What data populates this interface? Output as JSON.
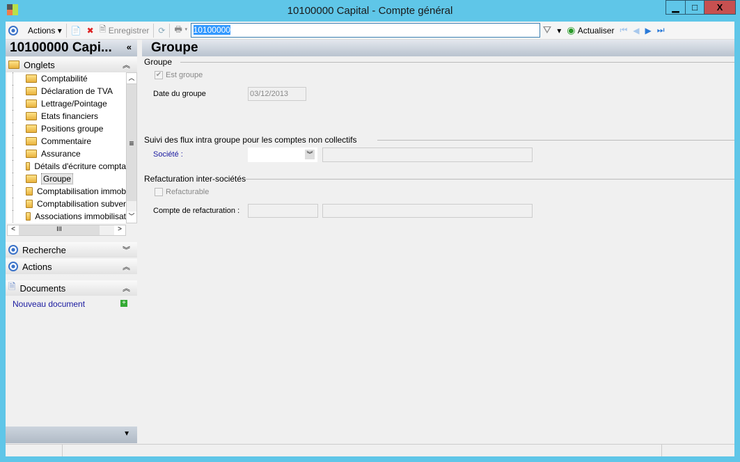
{
  "window": {
    "title": "10100000 Capital -  Compte général"
  },
  "toolbar": {
    "actions_label": "Actions",
    "save_label": "Enregistrer",
    "search_value": "10100000",
    "refresh_label": "Actualiser"
  },
  "left": {
    "title": "10100000 Capi...",
    "tabs_label": "Onglets",
    "tree": [
      "Comptabilité",
      "Déclaration de TVA",
      "Lettrage/Pointage",
      "Etats financiers",
      "Positions groupe",
      "Commentaire",
      "Assurance",
      "Détails d'écriture compta",
      "Groupe",
      "Comptabilisation immob",
      "Comptabilisation subver",
      "Associations immobilisat"
    ],
    "selected": "Groupe",
    "search_label": "Recherche",
    "actions_label": "Actions",
    "documents_label": "Documents",
    "new_doc_label": "Nouveau document"
  },
  "main": {
    "title": "Groupe",
    "group1": {
      "legend": "Groupe",
      "is_group_label": "Est groupe",
      "is_group_checked": true,
      "date_label": "Date du groupe",
      "date_value": "03/12/2013"
    },
    "group2": {
      "legend": "Suivi des flux intra groupe pour les comptes non collectifs",
      "company_label": "Société :",
      "company_value": "",
      "company_desc": ""
    },
    "group3": {
      "legend": "Refacturation inter-sociétés",
      "rebill_label": "Refacturable",
      "rebill_checked": false,
      "account_label": "Compte de refacturation :",
      "account_value": "",
      "account_desc": ""
    }
  }
}
